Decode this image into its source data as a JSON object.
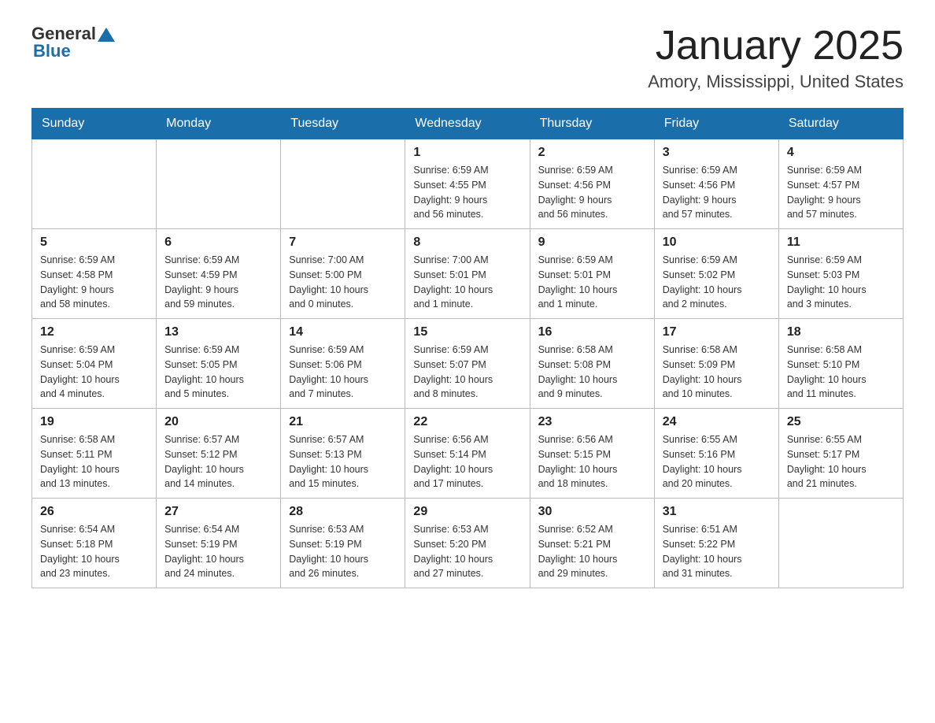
{
  "header": {
    "logo_general": "General",
    "logo_blue": "Blue",
    "month_title": "January 2025",
    "location": "Amory, Mississippi, United States"
  },
  "days_of_week": [
    "Sunday",
    "Monday",
    "Tuesday",
    "Wednesday",
    "Thursday",
    "Friday",
    "Saturday"
  ],
  "weeks": [
    [
      {
        "day": "",
        "info": ""
      },
      {
        "day": "",
        "info": ""
      },
      {
        "day": "",
        "info": ""
      },
      {
        "day": "1",
        "info": "Sunrise: 6:59 AM\nSunset: 4:55 PM\nDaylight: 9 hours\nand 56 minutes."
      },
      {
        "day": "2",
        "info": "Sunrise: 6:59 AM\nSunset: 4:56 PM\nDaylight: 9 hours\nand 56 minutes."
      },
      {
        "day": "3",
        "info": "Sunrise: 6:59 AM\nSunset: 4:56 PM\nDaylight: 9 hours\nand 57 minutes."
      },
      {
        "day": "4",
        "info": "Sunrise: 6:59 AM\nSunset: 4:57 PM\nDaylight: 9 hours\nand 57 minutes."
      }
    ],
    [
      {
        "day": "5",
        "info": "Sunrise: 6:59 AM\nSunset: 4:58 PM\nDaylight: 9 hours\nand 58 minutes."
      },
      {
        "day": "6",
        "info": "Sunrise: 6:59 AM\nSunset: 4:59 PM\nDaylight: 9 hours\nand 59 minutes."
      },
      {
        "day": "7",
        "info": "Sunrise: 7:00 AM\nSunset: 5:00 PM\nDaylight: 10 hours\nand 0 minutes."
      },
      {
        "day": "8",
        "info": "Sunrise: 7:00 AM\nSunset: 5:01 PM\nDaylight: 10 hours\nand 1 minute."
      },
      {
        "day": "9",
        "info": "Sunrise: 6:59 AM\nSunset: 5:01 PM\nDaylight: 10 hours\nand 1 minute."
      },
      {
        "day": "10",
        "info": "Sunrise: 6:59 AM\nSunset: 5:02 PM\nDaylight: 10 hours\nand 2 minutes."
      },
      {
        "day": "11",
        "info": "Sunrise: 6:59 AM\nSunset: 5:03 PM\nDaylight: 10 hours\nand 3 minutes."
      }
    ],
    [
      {
        "day": "12",
        "info": "Sunrise: 6:59 AM\nSunset: 5:04 PM\nDaylight: 10 hours\nand 4 minutes."
      },
      {
        "day": "13",
        "info": "Sunrise: 6:59 AM\nSunset: 5:05 PM\nDaylight: 10 hours\nand 5 minutes."
      },
      {
        "day": "14",
        "info": "Sunrise: 6:59 AM\nSunset: 5:06 PM\nDaylight: 10 hours\nand 7 minutes."
      },
      {
        "day": "15",
        "info": "Sunrise: 6:59 AM\nSunset: 5:07 PM\nDaylight: 10 hours\nand 8 minutes."
      },
      {
        "day": "16",
        "info": "Sunrise: 6:58 AM\nSunset: 5:08 PM\nDaylight: 10 hours\nand 9 minutes."
      },
      {
        "day": "17",
        "info": "Sunrise: 6:58 AM\nSunset: 5:09 PM\nDaylight: 10 hours\nand 10 minutes."
      },
      {
        "day": "18",
        "info": "Sunrise: 6:58 AM\nSunset: 5:10 PM\nDaylight: 10 hours\nand 11 minutes."
      }
    ],
    [
      {
        "day": "19",
        "info": "Sunrise: 6:58 AM\nSunset: 5:11 PM\nDaylight: 10 hours\nand 13 minutes."
      },
      {
        "day": "20",
        "info": "Sunrise: 6:57 AM\nSunset: 5:12 PM\nDaylight: 10 hours\nand 14 minutes."
      },
      {
        "day": "21",
        "info": "Sunrise: 6:57 AM\nSunset: 5:13 PM\nDaylight: 10 hours\nand 15 minutes."
      },
      {
        "day": "22",
        "info": "Sunrise: 6:56 AM\nSunset: 5:14 PM\nDaylight: 10 hours\nand 17 minutes."
      },
      {
        "day": "23",
        "info": "Sunrise: 6:56 AM\nSunset: 5:15 PM\nDaylight: 10 hours\nand 18 minutes."
      },
      {
        "day": "24",
        "info": "Sunrise: 6:55 AM\nSunset: 5:16 PM\nDaylight: 10 hours\nand 20 minutes."
      },
      {
        "day": "25",
        "info": "Sunrise: 6:55 AM\nSunset: 5:17 PM\nDaylight: 10 hours\nand 21 minutes."
      }
    ],
    [
      {
        "day": "26",
        "info": "Sunrise: 6:54 AM\nSunset: 5:18 PM\nDaylight: 10 hours\nand 23 minutes."
      },
      {
        "day": "27",
        "info": "Sunrise: 6:54 AM\nSunset: 5:19 PM\nDaylight: 10 hours\nand 24 minutes."
      },
      {
        "day": "28",
        "info": "Sunrise: 6:53 AM\nSunset: 5:19 PM\nDaylight: 10 hours\nand 26 minutes."
      },
      {
        "day": "29",
        "info": "Sunrise: 6:53 AM\nSunset: 5:20 PM\nDaylight: 10 hours\nand 27 minutes."
      },
      {
        "day": "30",
        "info": "Sunrise: 6:52 AM\nSunset: 5:21 PM\nDaylight: 10 hours\nand 29 minutes."
      },
      {
        "day": "31",
        "info": "Sunrise: 6:51 AM\nSunset: 5:22 PM\nDaylight: 10 hours\nand 31 minutes."
      },
      {
        "day": "",
        "info": ""
      }
    ]
  ]
}
